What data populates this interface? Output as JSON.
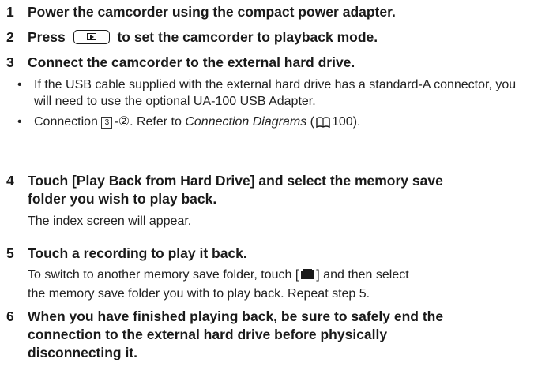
{
  "steps": [
    {
      "num": "1",
      "heading": "Power the camcorder using the compact power adapter."
    },
    {
      "num": "2",
      "heading_before": "Press",
      "button_icon": "playback-button-icon",
      "heading_after": "to set the camcorder to playback mode."
    },
    {
      "num": "3",
      "heading": "Connect the camcorder to the external hard drive.",
      "bullets": [
        {
          "text": "If the USB cable supplied with the external hard drive has a standard-A connector, you will need to use the optional UA-100 USB Adapter."
        },
        {
          "before": "Connection",
          "box_number": "3",
          "after_box": "-②. Refer to",
          "italic": "Connection Diagrams",
          "paren_open": "(",
          "page": "100",
          "paren_close": ")."
        }
      ]
    },
    {
      "num": "4",
      "heading_line1": "Touch [Play Back from Hard Drive] and select the memory save",
      "heading_line2": "folder you wish to play back.",
      "body": "The index screen will appear."
    },
    {
      "num": "5",
      "heading": "Touch a recording to play it back.",
      "body_before": "To switch to another memory save folder, touch [",
      "folder_icon": "folder-icon",
      "body_after": "] and then select",
      "body_line2": "the memory save folder you with to play back. Repeat step 5."
    },
    {
      "num": "6",
      "heading_line1": "When you have finished playing back, be sure to safely end the",
      "heading_line2": "connection to the external hard drive before physically",
      "heading_line3": "disconnecting it."
    }
  ],
  "icons": {
    "book": "book-reference-icon"
  }
}
